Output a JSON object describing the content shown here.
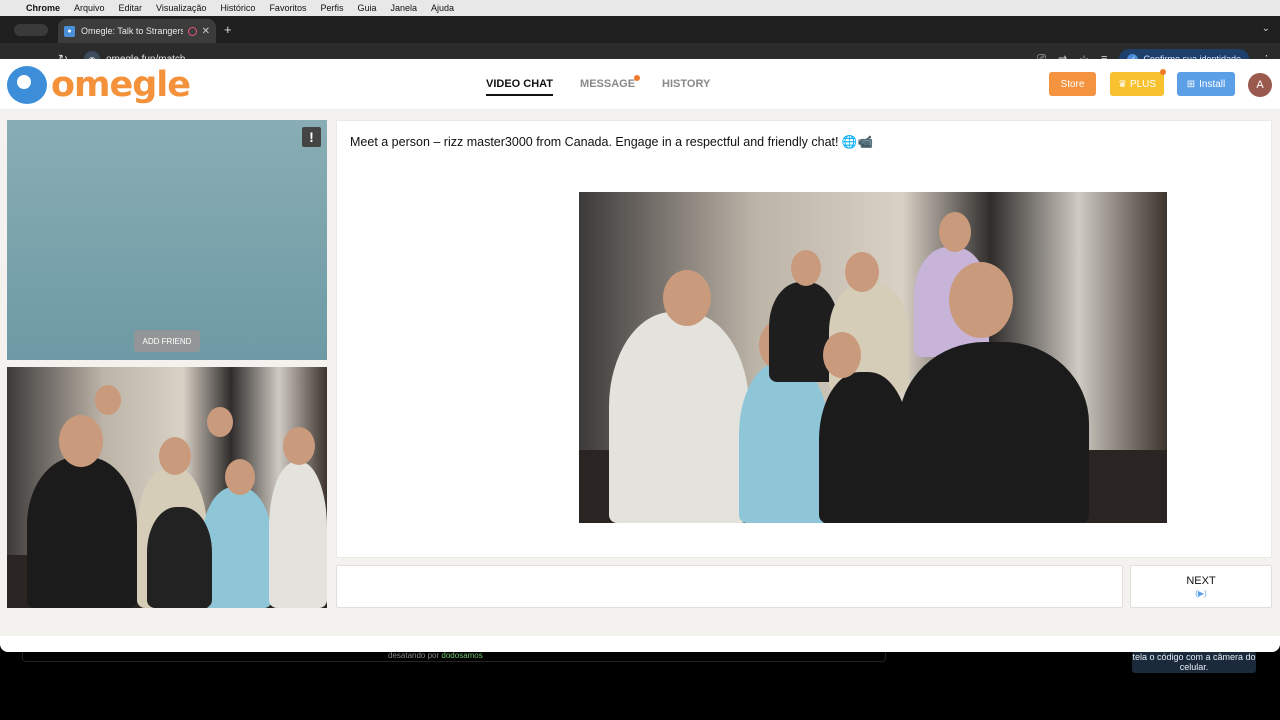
{
  "os_menu": {
    "app": "Chrome",
    "items": [
      "Arquivo",
      "Editar",
      "Visualização",
      "Histórico",
      "Favoritos",
      "Perfis",
      "Guia",
      "Janela",
      "Ajuda"
    ]
  },
  "browser": {
    "tab_title": "Omegle: Talk to Strangers",
    "url": "omegle.fun/match",
    "identity_button": "Confirme sua identidade"
  },
  "site": {
    "logo_text": "omegle",
    "nav": [
      {
        "label": "VIDEO CHAT",
        "active": true
      },
      {
        "label": "MESSAGE",
        "active": false,
        "notification": true
      },
      {
        "label": "HISTORY",
        "active": false
      }
    ],
    "buttons": {
      "store": "Store",
      "plus": "PLUS",
      "install": "Install"
    },
    "avatar_initial": "A",
    "brand_colors": {
      "logo_orange": "#f3923a",
      "logo_blue": "#3d8ed8",
      "store": "#f39340",
      "plus": "#f7c22e",
      "install": "#5b9fe6"
    }
  },
  "video": {
    "report_icon": "!",
    "add_friend": "ADD FRIEND"
  },
  "chat": {
    "intro_message": "Meet a person – rizz master3000 from Canada. Engage in a respectful and friendly chat! 🌐📹",
    "input_value": "",
    "next_label": "NEXT",
    "next_sub": "(▶)"
  },
  "desktop": {
    "note": "tela o código com a câmera do celular.",
    "footer_text_prefix": "desatando por",
    "footer_text_link": "dodosamos"
  }
}
